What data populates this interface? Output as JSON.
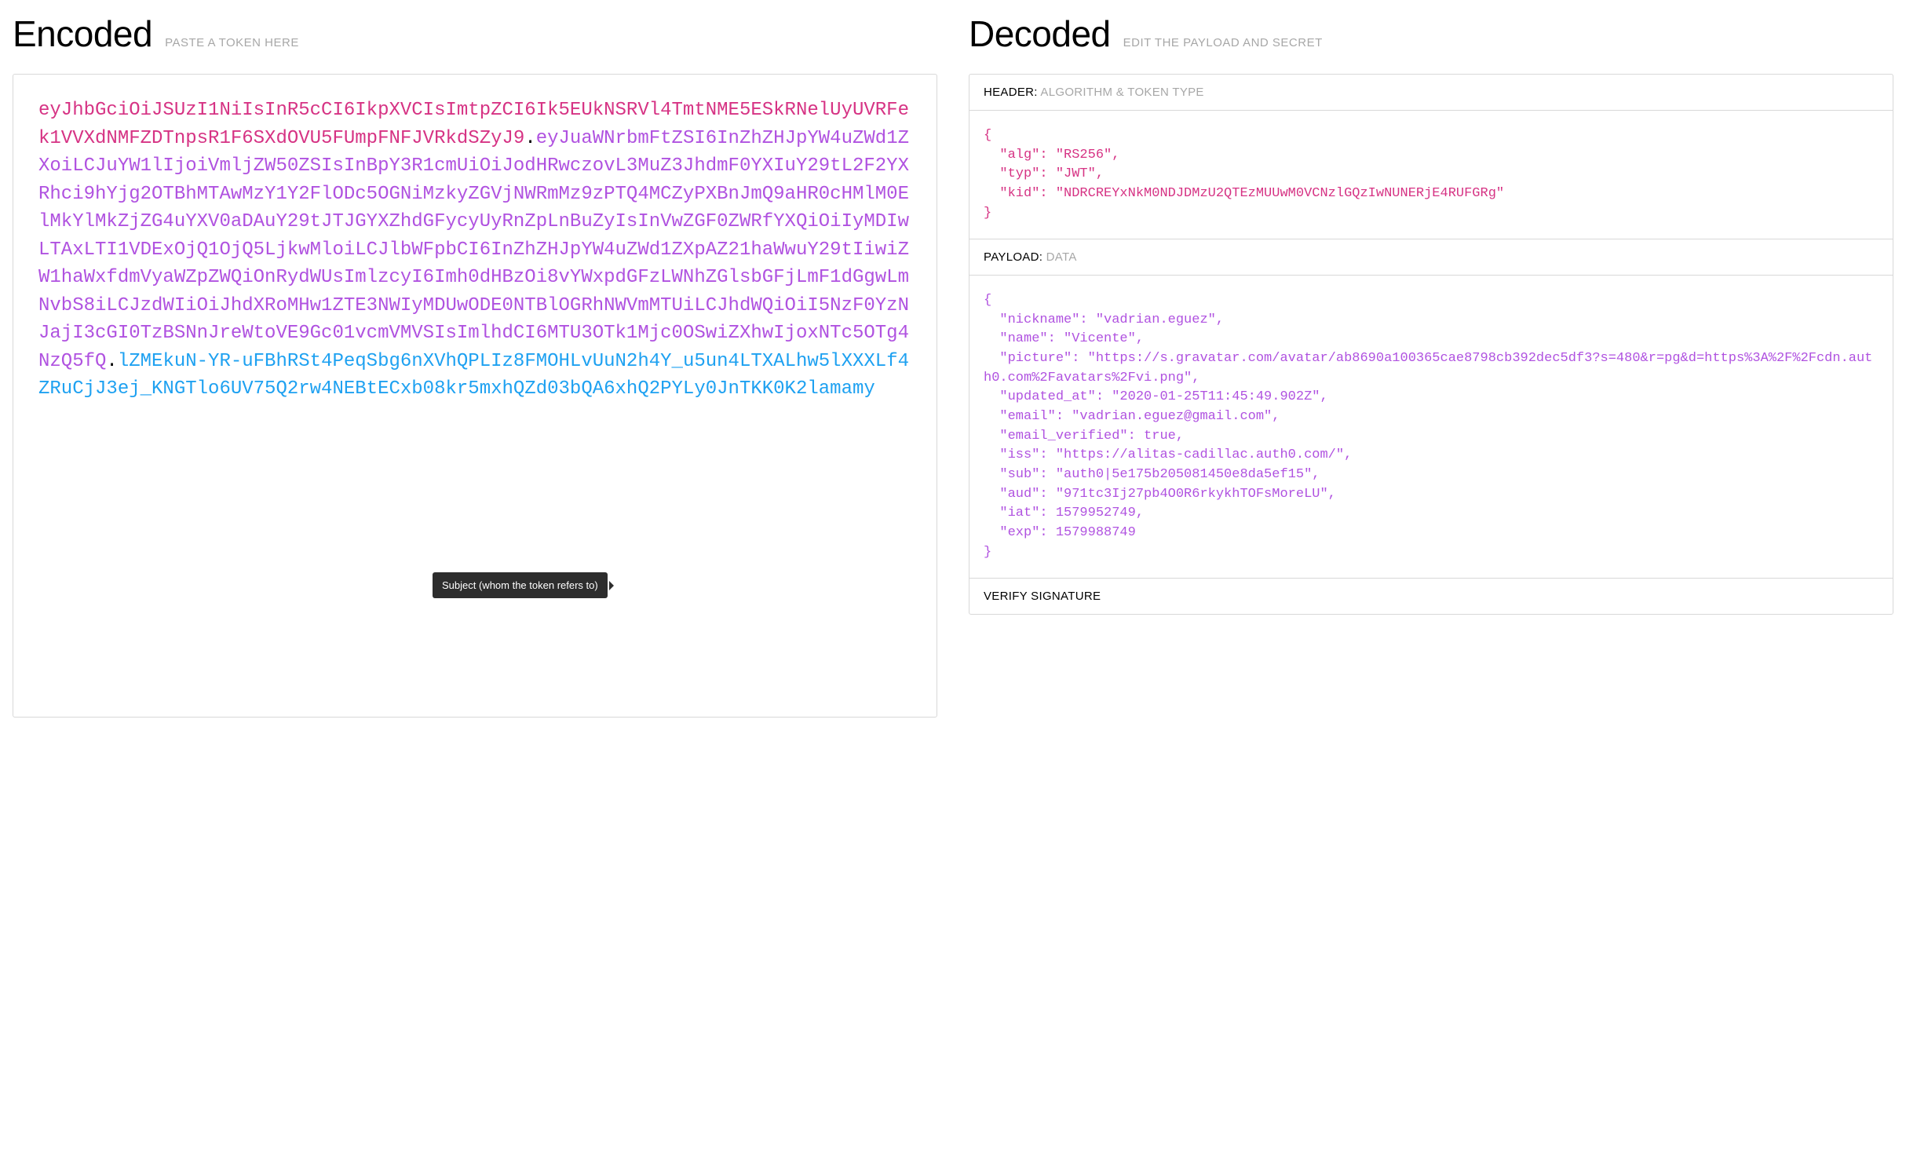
{
  "encoded": {
    "title": "Encoded",
    "hint": "PASTE A TOKEN HERE",
    "token": {
      "header": "eyJhbGciOiJSUzI1NiIsInR5cCI6IkpXVCIsImtpZCI6Ik5EUkNSRVl4TmtNME5ESkRNelUyUVRFek1VVXdNMFZDTnpsR1F6SXdOVU5FUmpFNFJVRkdSZyJ9",
      "payload": "eyJuaWNrbmFtZSI6InZhZHJpYW4uZWd1ZXoiLCJuYW1lIjoiVmljZW50ZSIsInBpY3R1cmUiOiJodHRwczovL3MuZ3JhdmF0YXIuY29tL2F2YXRhci9hYjg2OTBhMTAwMzY1Y2FlODc5OGNiMzkyZGVjNWRmMz9zPTQ4MCZyPXBnJmQ9aHR0cHMlM0ElMkYlMkZjZG4uYXV0aDAuY29tJTJGYXZhdGFycyUyRnZpLnBuZyIsInVwZGF0ZWRfYXQiOiIyMDIwLTAxLTI1VDExOjQ1OjQ5LjkwMloiLCJlbWFpbCI6InZhZHJpYW4uZWd1ZXpAZ21haWwuY29tIiwiZW1haWxfdmVyaWZpZWQiOnRydWUsImlzcyI6Imh0dHBzOi8vYWxpdGFzLWNhZGlsbGFjLmF1dGgwLmNvbS8iLCJzdWIiOiJhdXRoMHw1ZTE3NWIyMDUwODE0NTBlOGRhNWVmMTUiLCJhdWQiOiI5NzF0YzNJajI3cGI0TzBSNnJreWtoVE9Gc01vcmVMVSIsImlhdCI6MTU3OTk1Mjc0OSwiZXhwIjoxNTc5OTg4NzQ5fQ",
      "signature": "lZMEkuN-YR-uFBhRSt4PeqSbg6nXVhQPLIz8FMOHLvUuN2h4Y_u5un4LTXALhw5lXXXLf4ZRuCjJ3ej_KNGTlo6UV75Q2rw4NEBtECxb08kr5mxhQZd03bQA6xhQ2PYLy0JnTKK0K2lamamy"
    }
  },
  "decoded": {
    "title": "Decoded",
    "hint": "EDIT THE PAYLOAD AND SECRET",
    "sections": {
      "header": {
        "label": "HEADER:",
        "sublabel": "ALGORITHM & TOKEN TYPE",
        "body": "{\n  \"alg\": \"RS256\",\n  \"typ\": \"JWT\",\n  \"kid\": \"NDRCREYxNkM0NDJDMzU2QTEzMUUwM0VCNzlGQzIwNUNERjE4RUFGRg\"\n}"
      },
      "payload": {
        "label": "PAYLOAD:",
        "sublabel": "DATA",
        "body": "{\n  \"nickname\": \"vadrian.eguez\",\n  \"name\": \"Vicente\",\n  \"picture\": \"https://s.gravatar.com/avatar/ab8690a100365cae8798cb392dec5df3?s=480&r=pg&d=https%3A%2F%2Fcdn.auth0.com%2Favatars%2Fvi.png\",\n  \"updated_at\": \"2020-01-25T11:45:49.902Z\",\n  \"email\": \"vadrian.eguez@gmail.com\",\n  \"email_verified\": true,\n  \"iss\": \"https://alitas-cadillac.auth0.com/\",\n  \"sub\": \"auth0|5e175b205081450e8da5ef15\",\n  \"aud\": \"971tc3Ij27pb4O0R6rkykhTOFsMoreLU\",\n  \"iat\": 1579952749,\n  \"exp\": 1579988749\n}"
      },
      "verify": {
        "label": "VERIFY SIGNATURE"
      }
    }
  },
  "tooltip": {
    "text": "Subject (whom the token refers to)"
  }
}
